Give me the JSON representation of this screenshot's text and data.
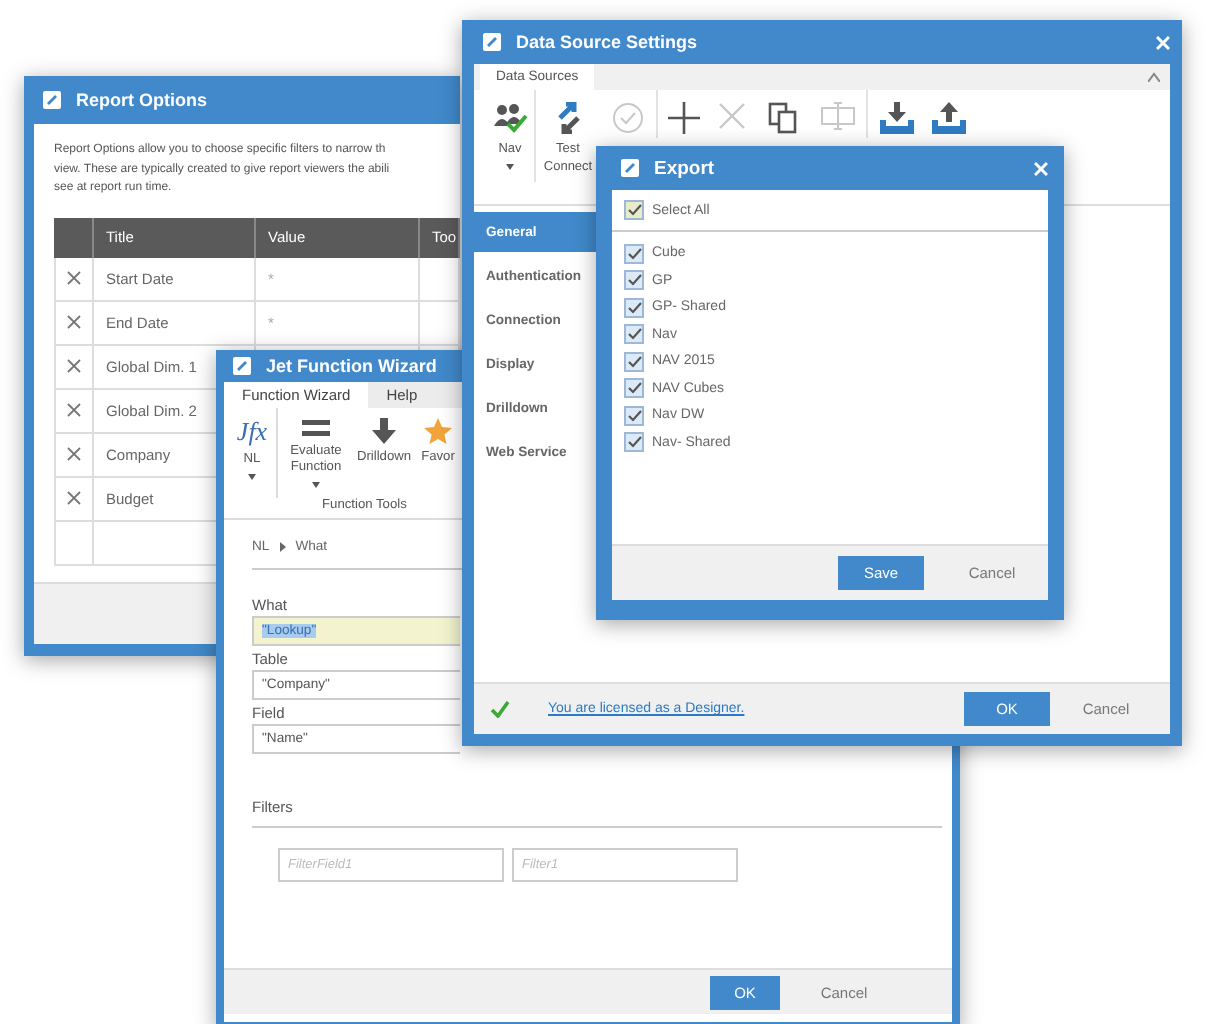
{
  "report_options": {
    "title": "Report Options",
    "description": "Report Options allow you to choose specific filters to narrow th\nview. These are typically created to give report viewers the abili\nsee at report run time.",
    "columns": [
      "Title",
      "Value",
      "Too"
    ],
    "rows": [
      {
        "title": "Start Date",
        "value": "*"
      },
      {
        "title": "End Date",
        "value": "*"
      },
      {
        "title": "Global Dim. 1"
      },
      {
        "title": "Global Dim. 2"
      },
      {
        "title": "Company"
      },
      {
        "title": "Budget"
      }
    ]
  },
  "function_wizard": {
    "title": "Jet Function Wizard",
    "tabs": [
      {
        "label": "Function Wizard",
        "selected": true
      },
      {
        "label": "Help",
        "selected": false
      }
    ],
    "tools": [
      {
        "kind": "fx",
        "icon_text": "Jfx",
        "label": "NL",
        "dropdown": true
      },
      {
        "kind": "evaluate",
        "label": "Evaluate Function",
        "dropdown": true
      },
      {
        "kind": "drilldown",
        "label": "Drilldown"
      },
      {
        "kind": "favorites",
        "label": "Favor"
      }
    ],
    "group_label": "Function Tools",
    "breadcrumb": [
      "NL",
      "What"
    ],
    "fields": [
      {
        "label": "What",
        "value": "\"Lookup\"",
        "highlighted": true
      },
      {
        "label": "Table",
        "value": "\"Company\"",
        "highlighted": false
      },
      {
        "label": "Field",
        "value": "\"Name\"",
        "highlighted": false
      }
    ],
    "filters_label": "Filters",
    "filters": [
      {
        "placeholder": "FilterField1"
      },
      {
        "placeholder": "Filter1"
      }
    ],
    "buttons": [
      {
        "label": "OK",
        "primary": true
      },
      {
        "label": "Cancel",
        "primary": false
      }
    ]
  },
  "data_source_settings": {
    "title": "Data Source Settings",
    "tab": "Data Sources",
    "toolbar": [
      {
        "kind": "nav",
        "label": "Nav",
        "dropdown": true,
        "disabled": false
      },
      {
        "kind": "test",
        "label": "Test Connect",
        "disabled": false
      },
      {
        "kind": "setup",
        "disabled": true
      },
      {
        "kind": "add",
        "disabled": false
      },
      {
        "kind": "delete",
        "disabled": true
      },
      {
        "kind": "copy",
        "disabled": false
      },
      {
        "kind": "rename",
        "disabled": true
      },
      {
        "kind": "import",
        "disabled": false
      },
      {
        "kind": "export",
        "disabled": false
      }
    ],
    "sidebar": [
      {
        "label": "General",
        "selected": true
      },
      {
        "label": "Authentication",
        "selected": false
      },
      {
        "label": "Connection",
        "selected": false
      },
      {
        "label": "Display",
        "selected": false
      },
      {
        "label": "Drilldown",
        "selected": false
      },
      {
        "label": "Web Service",
        "selected": false
      }
    ],
    "license": "You are licensed as a Designer.",
    "buttons": [
      {
        "label": "OK",
        "primary": true
      },
      {
        "label": "Cancel",
        "primary": false
      }
    ]
  },
  "export": {
    "title": "Export",
    "select_all": {
      "label": "Select All",
      "checked": true
    },
    "items": [
      {
        "label": "Cube",
        "checked": true
      },
      {
        "label": "GP",
        "checked": true
      },
      {
        "label": "GP- Shared",
        "checked": true
      },
      {
        "label": "Nav",
        "checked": true
      },
      {
        "label": "NAV 2015",
        "checked": true
      },
      {
        "label": "NAV Cubes",
        "checked": true
      },
      {
        "label": "Nav DW",
        "checked": true
      },
      {
        "label": "Nav- Shared",
        "checked": true
      }
    ],
    "buttons": [
      {
        "label": "Save",
        "primary": true
      },
      {
        "label": "Cancel",
        "primary": false
      }
    ]
  }
}
